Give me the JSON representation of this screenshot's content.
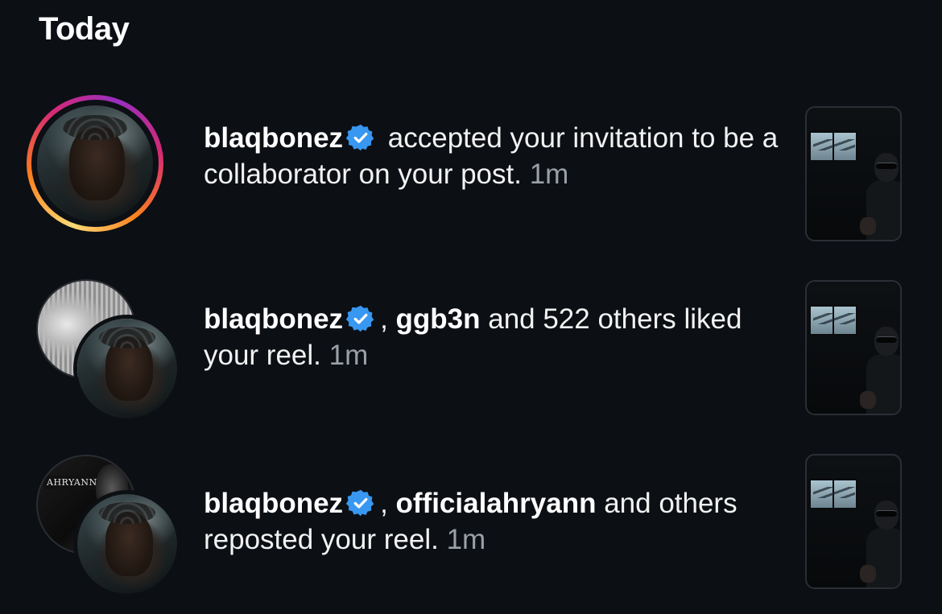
{
  "section": {
    "title": "Today"
  },
  "colors": {
    "background": "#0c0f14",
    "verified_badge": "#3897f0",
    "time_text": "#9aa0a6",
    "story_ring": [
      "#feda75",
      "#fa7e1e",
      "#d62976",
      "#962fbf"
    ]
  },
  "notifications": [
    {
      "user": "blaqbonez",
      "verified": true,
      "text_after_badge": " accepted your invitation to be a collaborator on your post.",
      "time": "1m",
      "avatar_icon": "story-ring-avatar",
      "thumbnail": "reel-thumbnail"
    },
    {
      "user": "blaqbonez",
      "verified": true,
      "separator": ", ",
      "second_user": "ggb3n",
      "text_after": " and 522 others liked your reel.",
      "time": "1m",
      "avatar_icon": "stacked-avatars",
      "thumbnail": "reel-thumbnail"
    },
    {
      "user": "blaqbonez",
      "verified": true,
      "separator": ", ",
      "second_user": "officialahryann",
      "text_after": " and others reposted your reel.",
      "time": "1m",
      "avatar_icon": "stacked-avatars",
      "back_avatar_logo": "AHRYANN",
      "thumbnail": "reel-thumbnail"
    }
  ]
}
